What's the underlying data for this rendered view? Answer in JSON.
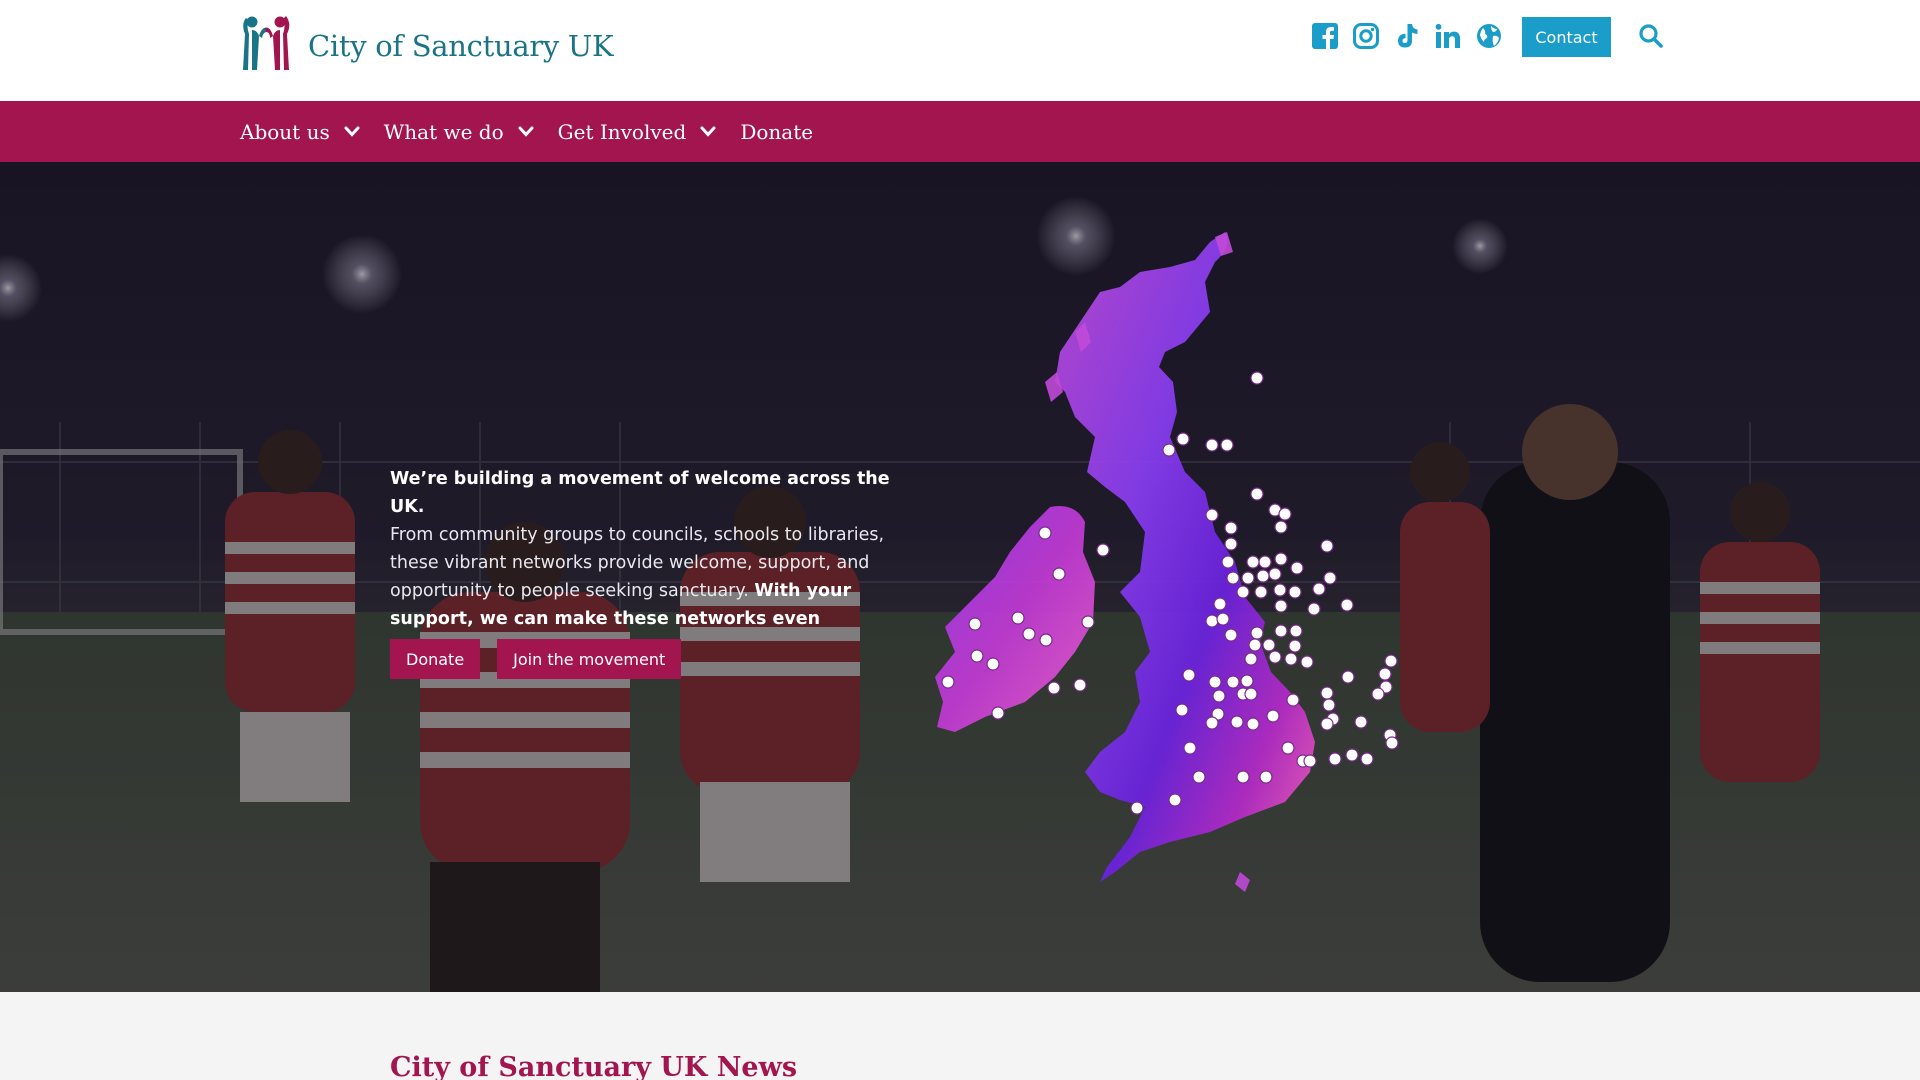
{
  "site": {
    "name": "City of Sanctuary UK",
    "colors": {
      "teal": "#1a7488",
      "magenta": "#a3154f",
      "contact_blue": "#1a9ec9",
      "icon_blue": "#1a9ec9"
    }
  },
  "header": {
    "social_icons": [
      "facebook-icon",
      "instagram-icon",
      "tiktok-icon",
      "linkedin-icon",
      "globe-icon"
    ],
    "contact_label": "Contact",
    "search_icon": "search-icon"
  },
  "nav": {
    "items": [
      {
        "label": "About us",
        "has_dropdown": true
      },
      {
        "label": "What we do",
        "has_dropdown": true
      },
      {
        "label": "Get Involved",
        "has_dropdown": true
      },
      {
        "label": "Donate",
        "has_dropdown": false
      }
    ]
  },
  "hero": {
    "heading": "We’re building a movement of welcome across the UK.",
    "body": "From community groups to councils, schools to libraries, these vibrant networks provide welcome, support, and opportunity to people seeking sanctuary.",
    "emphasis": "With your support, we can make these networks even stronger.",
    "buttons": {
      "donate": "Donate",
      "join": "Join the movement"
    }
  },
  "news": {
    "title": "City of Sanctuary UK News"
  }
}
